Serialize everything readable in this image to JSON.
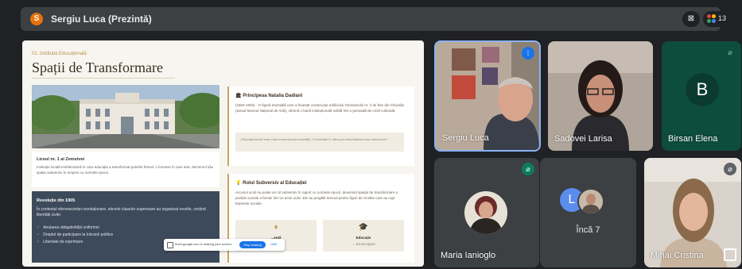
{
  "topbar": {
    "presenter_initial": "S",
    "presenter_label": "Sergiu Luca (Prezintă)",
    "participants_count": "13"
  },
  "slide": {
    "kicker": "01. Instituția Educațională",
    "title": "Spații de Transformare",
    "level_card": {
      "heading": "Liceul nr. 1 al Zemstvei",
      "text": "Instituție locală emblematică în care educația a transformat puterile femeii: o formare în care arte, demersul său spațiu subversiv în respect cu normele epocii."
    },
    "revolution_card": {
      "heading": "Revoluție din 1905",
      "text": "În contextul efervescenței revoluționare, elevele claselor superioare au organizat revolte, cerând libertății civile:",
      "items": [
        "Anularea obligativității uniformei",
        "Dreptul de participare la întruniri politice",
        "Libertate de exprimare"
      ]
    },
    "princess_card": {
      "icon": "🏛",
      "heading": "Principesa Natalia Dadiani",
      "text": "(1862-1903) · O figură esențială care a finanțat construcția edificiului Gimnaziului nr. 2 de fete din Chișinău (actual Muzeul Național de Artă), oferind o bază instituțională solidă într-o perioadă de criză culturală.",
      "quote": "„Educația femeii este chiar emanciparea societății. O investiție în viitor prin deschiderea unor mărți-lume.”"
    },
    "role_card": {
      "icon": "💡",
      "heading": "Rolul Subversiv al Educației",
      "text": "Accesul școli nu poate un rol subversiv în raport cu normele epocii, devenind spațiul de transformare a poziției sociale a femeii într-un actor activ. Ele au pregătit terenul pentru figuri de cinstite care au rupt barierele sociale.",
      "box_left": {
        "icon": "♦",
        "line1": "...ență",
        "line2": "...s"
      },
      "box_right": {
        "icon": "🎓",
        "line1": "Educație",
        "line2": "→ Emancipare"
      }
    },
    "share_bar": {
      "message": "meet.google.com is sharing your screen.",
      "stop_label": "Stop sharing",
      "hide_label": "Hide"
    }
  },
  "participants": {
    "sergiu": "Sergiu Luca",
    "sadovei": "Sadovei Larisa",
    "birsan": "Birsan Elena",
    "birsan_initial": "B",
    "maria": "Maria Ianioglo",
    "inca": "Încă 7",
    "inca_initial": "L",
    "mihai": "Mihai Cristina"
  },
  "colors": {
    "accent": "#8ab4f8",
    "badge_speaking": "#1a73e8",
    "badge_muted_green": "#0d7a5f",
    "slide_bg": "#f7f5ef",
    "gold": "#c9a45c"
  }
}
